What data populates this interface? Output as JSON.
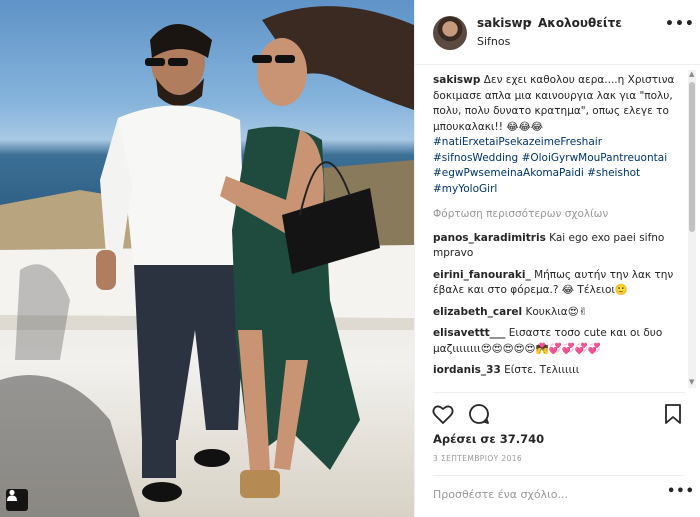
{
  "post": {
    "username": "sakiswp",
    "separator": "•",
    "follow_label": "Ακολουθείτε",
    "location": "Sifnos",
    "more_label": "•••"
  },
  "caption": {
    "username": "sakiswp",
    "text": "Δεν εχει καθολου αερα....η Χριστινα δοκιμασε απλα μια καινουργια λακ για \"πολυ, πολυ, πολυ δυνατο κρατημα\", οπως ελεγε το μπουκαλακι!! 😂😂😂",
    "hashtags": [
      "#natiErxetaiPsekazeimeFreshair",
      "#sifnosWedding",
      "#OloiGyrwMouPantreuontai",
      "#egwPwsemeinaAkomaPaidi",
      "#sheishot",
      "#myYoloGirl"
    ]
  },
  "load_more_label": "Φόρτωση περισσότερων σχολίων",
  "comments": [
    {
      "user": "panos_karadimitris",
      "text": "Kai ego exo paei sifno mpravo"
    },
    {
      "user": "eirini_fanouraki_",
      "text": "Μήπως αυτήν την λακ την έβαλε και στο φόρεμα.? 😂 Τέλειοι🙂"
    },
    {
      "user": "elizabeth_carel",
      "text": "Κουκλια😍✌"
    },
    {
      "user": "elisavettt___",
      "text": "Eισαστε τοσο cute και οι δυο μαζιιιιιιιι😍😍😍😍😍💏💞💞💞💞"
    },
    {
      "user": "iordanis_33",
      "text": "Είστε. Τελιιιιιι"
    }
  ],
  "actions": {
    "likes_text": "Αρέσει σε 37.740",
    "date_text": "3 ΣΕΠΤΕΜΒΡΙΟΥ 2016",
    "comment_placeholder": "Προσθέστε ένα σχόλιο...",
    "more_label": "•••"
  },
  "scrollbar": {
    "up": "▲",
    "down": "▼"
  }
}
